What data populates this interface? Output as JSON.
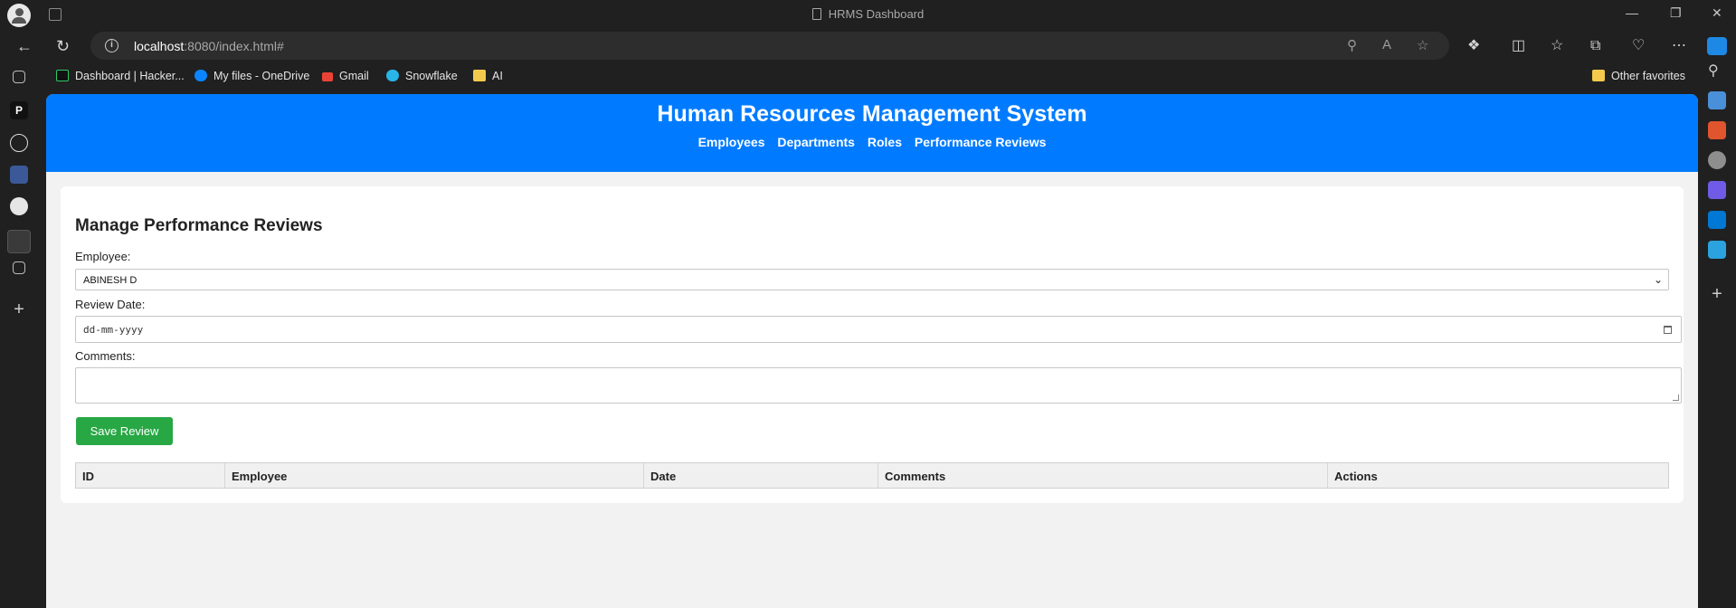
{
  "browser": {
    "tab_title": "HRMS Dashboard",
    "url_host": "localhost",
    "url_rest": ":8080/index.html#",
    "favorites": [
      {
        "label": "Dashboard | Hacker...",
        "icon": "hackerrank-icon"
      },
      {
        "label": "My files - OneDrive",
        "icon": "onedrive-icon"
      },
      {
        "label": "Gmail",
        "icon": "gmail-icon"
      },
      {
        "label": "Snowflake",
        "icon": "snowflake-icon"
      },
      {
        "label": "AI",
        "icon": "folder-icon"
      }
    ],
    "other_favorites": "Other favorites"
  },
  "site": {
    "title": "Human Resources Management System",
    "nav": [
      "Employees",
      "Departments",
      "Roles",
      "Performance Reviews"
    ]
  },
  "form": {
    "heading": "Manage Performance Reviews",
    "employee_label": "Employee:",
    "employee_value": "ABINESH D",
    "date_label": "Review Date:",
    "date_placeholder": "dd-mm-yyyy",
    "comments_label": "Comments:",
    "comments_value": "",
    "save_label": "Save Review"
  },
  "table": {
    "columns": [
      "ID",
      "Employee",
      "Date",
      "Comments",
      "Actions"
    ]
  },
  "colors": {
    "header": "#007bff",
    "save_button": "#28a745"
  }
}
